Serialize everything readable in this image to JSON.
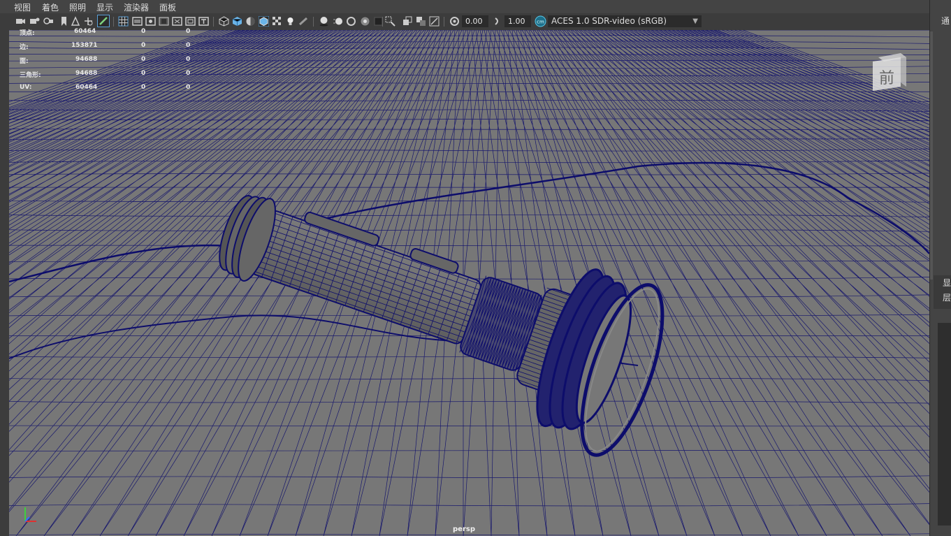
{
  "menu": [
    "视图",
    "着色",
    "照明",
    "显示",
    "渲染器",
    "面板"
  ],
  "toolbar": {
    "exposure": "0.00",
    "gamma": "1.00",
    "color_space": "ACES 1.0 SDR-video (sRGB)"
  },
  "hud": {
    "rows": [
      {
        "label": "顶点:",
        "total": "60464",
        "selected": "0",
        "component": "0"
      },
      {
        "label": "边:",
        "total": "153871",
        "selected": "0",
        "component": "0"
      },
      {
        "label": "面:",
        "total": "94688",
        "selected": "0",
        "component": "0"
      },
      {
        "label": "三角形:",
        "total": "94688",
        "selected": "0",
        "component": "0"
      },
      {
        "label": "UV:",
        "total": "60464",
        "selected": "0",
        "component": "0"
      }
    ]
  },
  "viewcube": {
    "face": "前"
  },
  "camera_label": "persp",
  "right_panel": {
    "top_label": "通",
    "labels": [
      "显",
      "层"
    ]
  },
  "colors": {
    "wire": "#0d0d6b",
    "viewport_bg": "#777777",
    "ui_bg": "#444444",
    "active_icon": "#5aa0d8"
  }
}
